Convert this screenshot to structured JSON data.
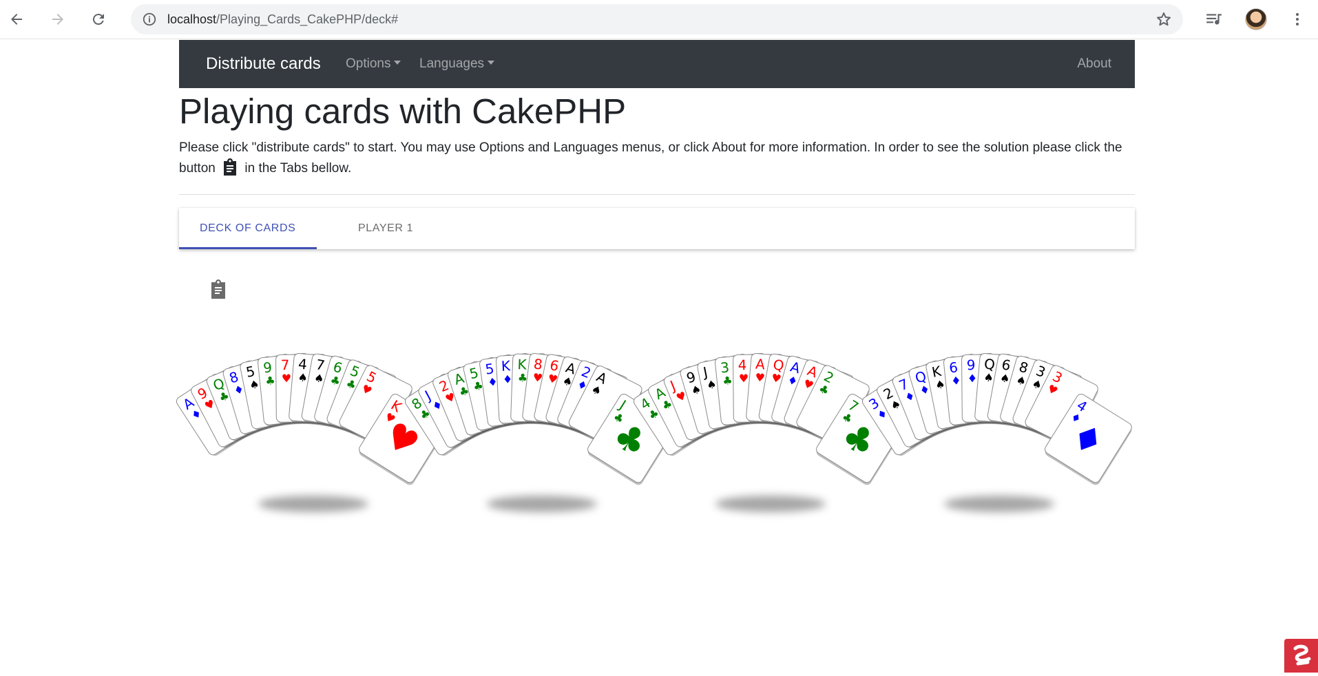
{
  "browser": {
    "url_host": "localhost",
    "url_path": "/Playing_Cards_CakePHP/deck#"
  },
  "navbar": {
    "brand": "Distribute cards",
    "options": "Options",
    "languages": "Languages",
    "about": "About"
  },
  "page": {
    "title": "Playing cards with CakePHP",
    "lead_part1": "Please click \"distribute cards\" to start. You may use Options and Languages menus, or click About for more information. In order to see the solution please click the button",
    "lead_part2": "in the Tabs bellow."
  },
  "tabs": [
    {
      "label": "DECK OF CARDS",
      "active": true
    },
    {
      "label": "PLAYER 1",
      "active": false
    }
  ],
  "colors": {
    "hearts": "#ff0000",
    "diamonds": "#0000ff",
    "clubs": "#008000",
    "spades": "#000000",
    "navbar": "#343a40",
    "tab_accent": "#3f51b5"
  },
  "hands": [
    {
      "cards": [
        {
          "rank": "A",
          "suit": "diamonds"
        },
        {
          "rank": "9",
          "suit": "hearts"
        },
        {
          "rank": "Q",
          "suit": "clubs"
        },
        {
          "rank": "8",
          "suit": "diamonds"
        },
        {
          "rank": "5",
          "suit": "spades"
        },
        {
          "rank": "9",
          "suit": "clubs"
        },
        {
          "rank": "7",
          "suit": "hearts"
        },
        {
          "rank": "4",
          "suit": "spades"
        },
        {
          "rank": "7",
          "suit": "spades"
        },
        {
          "rank": "6",
          "suit": "clubs"
        },
        {
          "rank": "5",
          "suit": "clubs"
        },
        {
          "rank": "5",
          "suit": "hearts"
        },
        {
          "rank": "K",
          "suit": "hearts"
        }
      ]
    },
    {
      "cards": [
        {
          "rank": "8",
          "suit": "clubs"
        },
        {
          "rank": "J",
          "suit": "diamonds"
        },
        {
          "rank": "2",
          "suit": "hearts"
        },
        {
          "rank": "A",
          "suit": "clubs"
        },
        {
          "rank": "5",
          "suit": "clubs"
        },
        {
          "rank": "5",
          "suit": "diamonds"
        },
        {
          "rank": "K",
          "suit": "diamonds"
        },
        {
          "rank": "K",
          "suit": "clubs"
        },
        {
          "rank": "8",
          "suit": "hearts"
        },
        {
          "rank": "6",
          "suit": "hearts"
        },
        {
          "rank": "A",
          "suit": "spades"
        },
        {
          "rank": "2",
          "suit": "diamonds"
        },
        {
          "rank": "A",
          "suit": "spades"
        },
        {
          "rank": "J",
          "suit": "clubs"
        }
      ]
    },
    {
      "cards": [
        {
          "rank": "4",
          "suit": "clubs"
        },
        {
          "rank": "A",
          "suit": "clubs"
        },
        {
          "rank": "J",
          "suit": "hearts"
        },
        {
          "rank": "9",
          "suit": "spades"
        },
        {
          "rank": "J",
          "suit": "spades"
        },
        {
          "rank": "3",
          "suit": "clubs"
        },
        {
          "rank": "4",
          "suit": "hearts"
        },
        {
          "rank": "A",
          "suit": "hearts"
        },
        {
          "rank": "Q",
          "suit": "hearts"
        },
        {
          "rank": "A",
          "suit": "diamonds"
        },
        {
          "rank": "A",
          "suit": "hearts"
        },
        {
          "rank": "2",
          "suit": "clubs"
        },
        {
          "rank": "7",
          "suit": "clubs"
        }
      ]
    },
    {
      "cards": [
        {
          "rank": "3",
          "suit": "diamonds"
        },
        {
          "rank": "2",
          "suit": "spades"
        },
        {
          "rank": "7",
          "suit": "diamonds"
        },
        {
          "rank": "Q",
          "suit": "diamonds"
        },
        {
          "rank": "K",
          "suit": "spades"
        },
        {
          "rank": "6",
          "suit": "diamonds"
        },
        {
          "rank": "9",
          "suit": "diamonds"
        },
        {
          "rank": "Q",
          "suit": "spades"
        },
        {
          "rank": "6",
          "suit": "spades"
        },
        {
          "rank": "8",
          "suit": "spades"
        },
        {
          "rank": "3",
          "suit": "spades"
        },
        {
          "rank": "3",
          "suit": "hearts"
        },
        {
          "rank": "4",
          "suit": "diamonds"
        }
      ]
    }
  ]
}
